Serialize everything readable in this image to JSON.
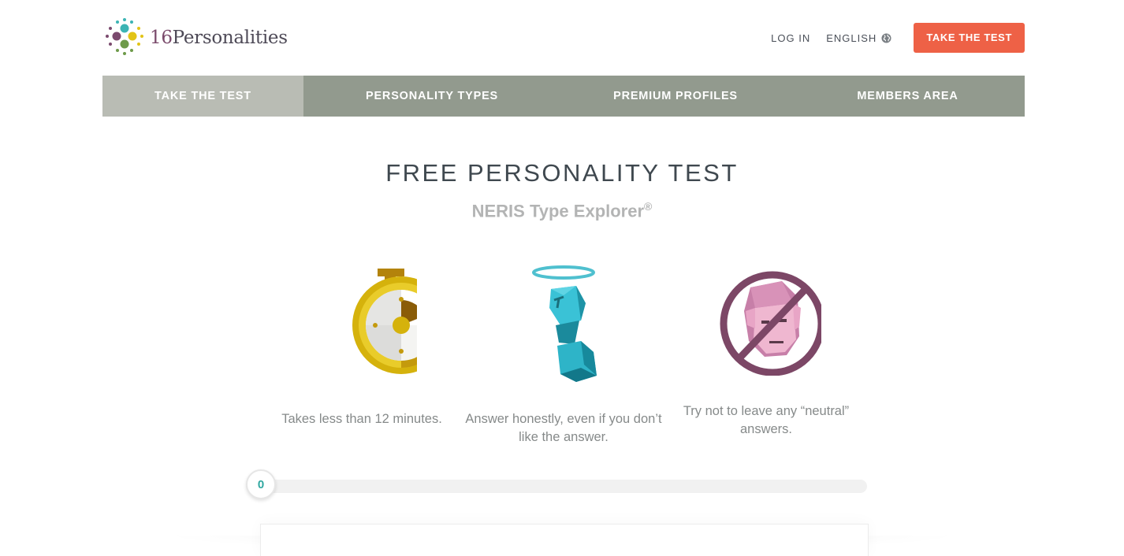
{
  "header": {
    "logo_text": "16Personalities",
    "logo_number": "16",
    "logo_word": "Personalities",
    "login_label": "LOG IN",
    "language_label": "ENGLISH",
    "language_icon": "globe-icon",
    "cta_label": "TAKE THE TEST"
  },
  "nav": {
    "items": [
      {
        "label": "TAKE THE TEST",
        "active": true
      },
      {
        "label": "PERSONALITY TYPES",
        "active": false
      },
      {
        "label": "PREMIUM PROFILES",
        "active": false
      },
      {
        "label": "MEMBERS AREA",
        "active": false
      }
    ]
  },
  "hero": {
    "title": "FREE PERSONALITY TEST",
    "subtitle": "NERIS Type Explorer",
    "subtitle_mark": "®"
  },
  "features": [
    {
      "icon": "stopwatch-icon",
      "text": "Takes less than 12 minutes."
    },
    {
      "icon": "statue-halo-icon",
      "text": "Answer honestly, even if you don’t like the answer."
    },
    {
      "icon": "no-neutral-face-icon",
      "text": "Try not to leave any “neutral” answers."
    }
  ],
  "progress": {
    "value_label": "0",
    "fraction": 0
  },
  "colors": {
    "accent": "#ee6146",
    "nav_bg": "#929a8e",
    "nav_active": "#b9bcb4",
    "progress_text": "#2fa7a0"
  }
}
